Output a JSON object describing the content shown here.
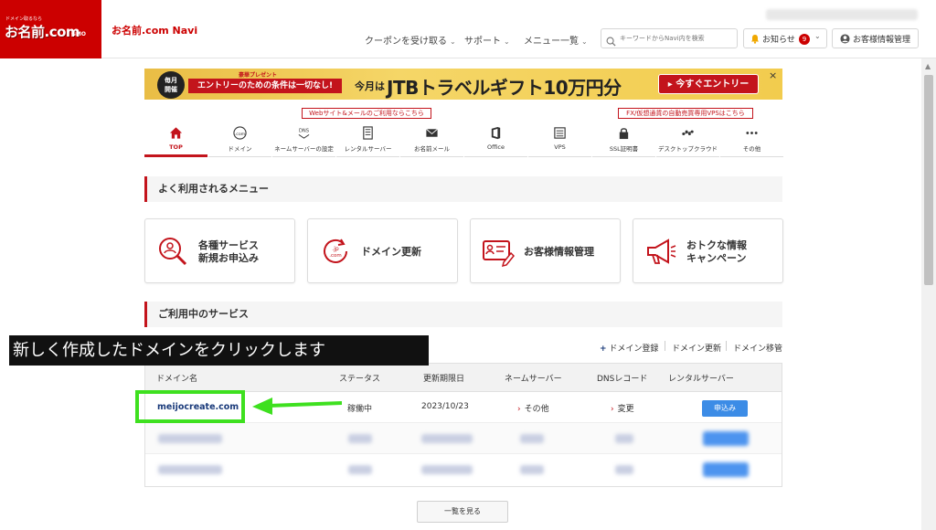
{
  "header": {
    "logo_tagline": "ドメイン取るなら",
    "logo_main": "お名前.com",
    "logo_gmo": "GMO",
    "navi_title": "お名前.com Navi",
    "nav": [
      {
        "label": "クーポンを受け取る"
      },
      {
        "label": "サポート"
      },
      {
        "label": "メニュー一覧"
      }
    ],
    "search_placeholder": "キーワードからNavi内を検索",
    "notice_label": "お知らせ",
    "notice_count": "9",
    "account_label": "お客様情報管理"
  },
  "banner": {
    "circle_text": "毎月\n開催",
    "small_text": "豪華プレゼント",
    "red_text": "エントリーのための条件は一切なし!",
    "prefix": "今月は",
    "headline": "JTBトラベルギフト10万円分",
    "button": "今すぐエントリー",
    "close": "×"
  },
  "callouts": {
    "web_mail": "Webサイト&メールのご利用ならこちら",
    "fx_vps": "FX/仮想通貨の自動売買専用VPSはこちら"
  },
  "categories": [
    {
      "label": "TOP",
      "icon": "home-icon"
    },
    {
      "label": "ドメイン",
      "icon": "domain-icon"
    },
    {
      "label": "ネームサーバーの設定",
      "icon": "dns-icon"
    },
    {
      "label": "レンタルサーバー",
      "icon": "server-icon"
    },
    {
      "label": "お名前メール",
      "icon": "mail-icon"
    },
    {
      "label": "Office",
      "icon": "office-icon"
    },
    {
      "label": "VPS",
      "icon": "vps-icon"
    },
    {
      "label": "SSL証明書",
      "icon": "lock-icon"
    },
    {
      "label": "デスクトップクラウド",
      "icon": "cloud-icon"
    },
    {
      "label": "その他",
      "icon": "more-icon"
    }
  ],
  "frequent": {
    "title": "よく利用されるメニュー",
    "cards": [
      {
        "label": "各種サービス\n新規お申込み",
        "icon": "service-search-icon"
      },
      {
        "label": "ドメイン更新",
        "icon": "domain-renew-icon"
      },
      {
        "label": "お客様情報管理",
        "icon": "customer-info-icon"
      },
      {
        "label": "おトクな情報\nキャンペーン",
        "icon": "megaphone-icon"
      }
    ]
  },
  "services": {
    "title": "ご利用中のサービス",
    "links": [
      {
        "label": "ドメイン登録",
        "prefix": "+"
      },
      {
        "label": "ドメイン更新"
      },
      {
        "label": "ドメイン移管"
      }
    ],
    "columns": [
      "ドメイン名",
      "ステータス",
      "更新期限日",
      "ネームサーバー",
      "DNSレコード",
      "レンタルサーバー"
    ],
    "row": {
      "domain": "meijocreate.com",
      "status": "稼働中",
      "expiry": "2023/10/23",
      "nameserver": "その他",
      "dns": "変更",
      "server_button": "申込み"
    },
    "more_button": "一覧を見る"
  },
  "overlay": {
    "caption": "新しく作成したドメインをクリックします"
  },
  "colors": {
    "brand_red": "#cc0000",
    "accent_red": "#c3141c",
    "highlight_green": "#3ee01f",
    "apply_blue": "#3c8ce6"
  }
}
